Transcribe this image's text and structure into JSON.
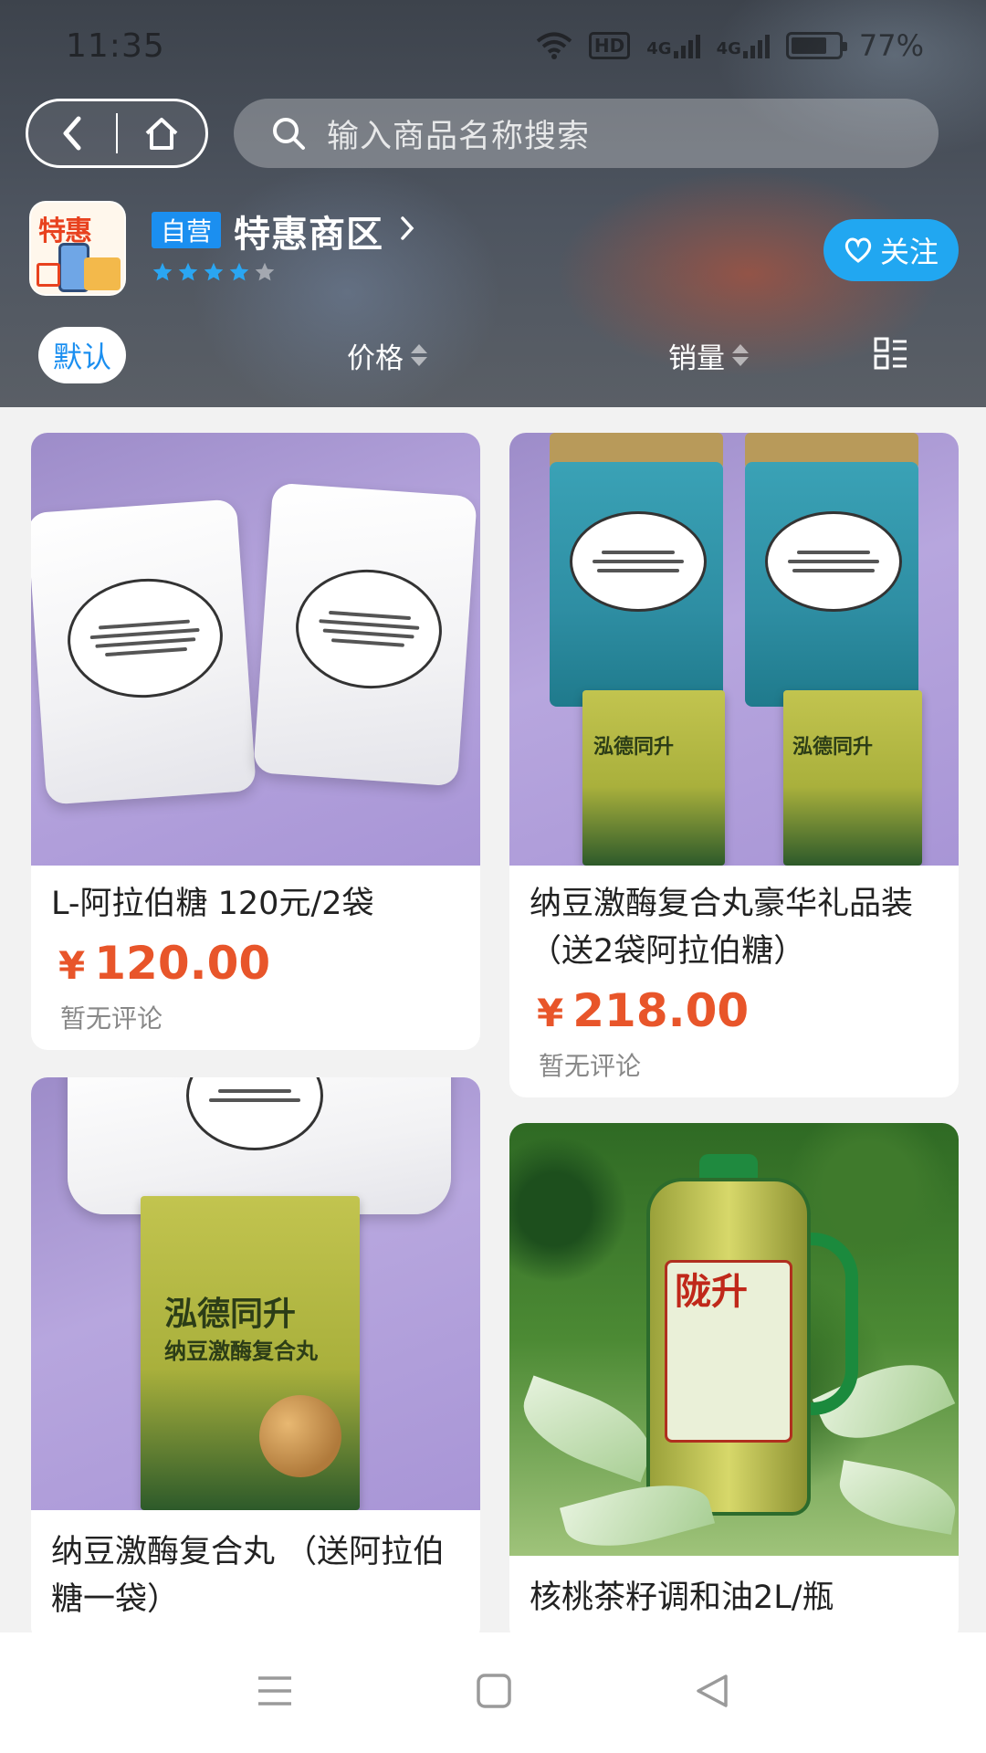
{
  "status_bar": {
    "time": "11:35",
    "battery": "77%",
    "battery_level": 0.77,
    "hd_label": "HD",
    "network_label": "4G"
  },
  "nav": {
    "back_icon": "chevron-left-icon",
    "home_icon": "home-icon",
    "search": {
      "placeholder": "输入商品名称搜索",
      "icon": "search-icon"
    }
  },
  "store": {
    "logo_text": "特惠",
    "badge": "自营",
    "name": "特惠商区",
    "rating_stars": 4,
    "rating_max": 5,
    "follow_label": "关注"
  },
  "sort": {
    "default_label": "默认",
    "price_label": "价格",
    "sales_label": "销量",
    "layout_icon": "grid-list-icon"
  },
  "products": [
    {
      "title": "L-阿拉伯糖 120元/2袋",
      "price": "120.00",
      "currency": "¥",
      "review": "暂无评论"
    },
    {
      "title": "纳豆激酶复合丸豪华礼品装（送2袋阿拉伯糖）",
      "price": "218.00",
      "currency": "¥",
      "review": "暂无评论"
    },
    {
      "title": "纳豆激酶复合丸 （送阿拉伯糖一袋）"
    },
    {
      "title": "核桃茶籽调和油2L/瓶"
    }
  ],
  "image_text": {
    "box_brand": "泓德同升",
    "box_product": "纳豆激酶复合丸",
    "oil_brand": "陇升"
  },
  "colors": {
    "accent_blue": "#1b8ff0",
    "follow_blue": "#21a7f1",
    "price_orange": "#e8552a"
  },
  "system_nav": {
    "menu_icon": "menu-icon",
    "home_icon": "square-home-icon",
    "back_icon": "triangle-back-icon"
  }
}
